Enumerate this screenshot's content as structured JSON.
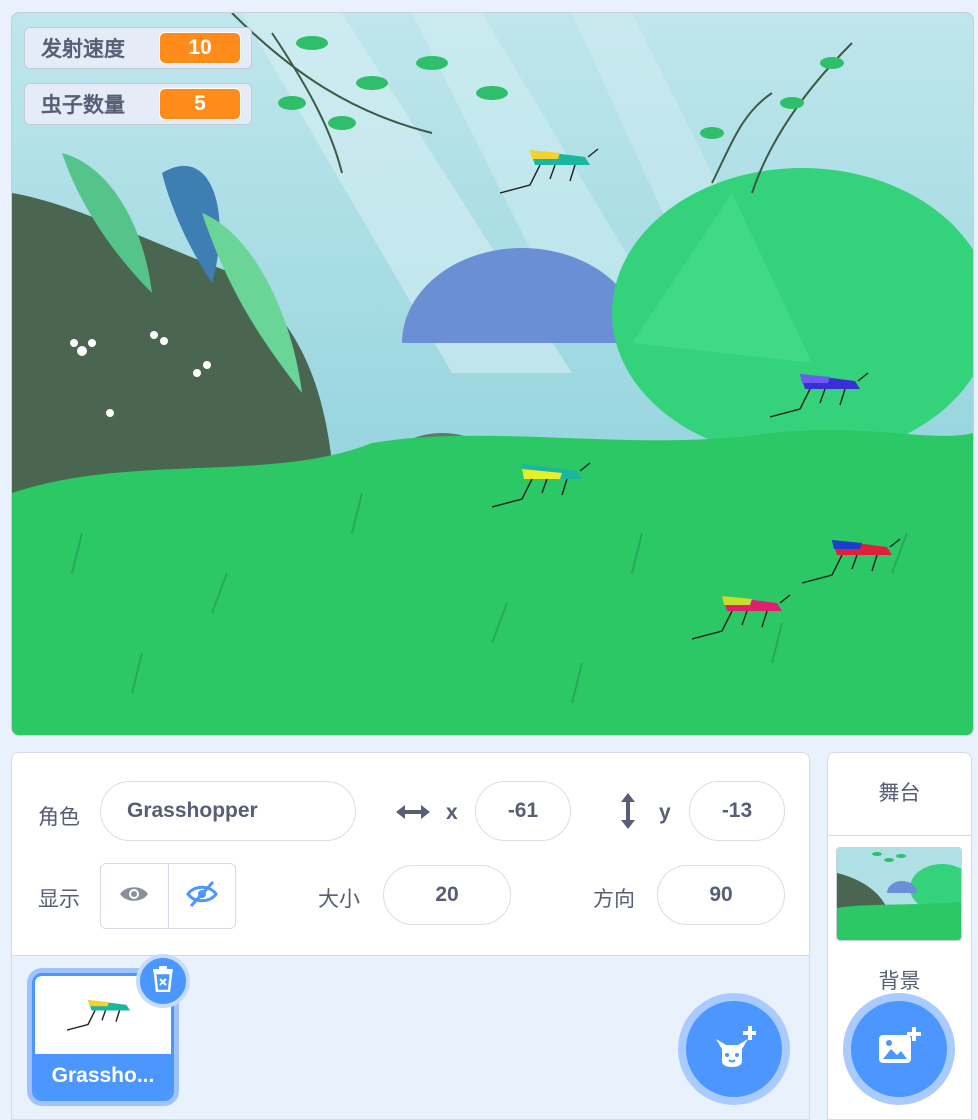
{
  "monitors": [
    {
      "label": "发射速度",
      "value": "10"
    },
    {
      "label": "虫子数量",
      "value": "5"
    }
  ],
  "sprite_info": {
    "sprite_label": "角色",
    "sprite_name": "Grasshopper",
    "x_label": "x",
    "x_value": "-61",
    "y_label": "y",
    "y_value": "-13",
    "show_label": "显示",
    "size_label": "大小",
    "size_value": "20",
    "direction_label": "方向",
    "direction_value": "90"
  },
  "sprite_list": [
    {
      "name": "Grassho..."
    }
  ],
  "stage_panel": {
    "title": "舞台",
    "backdrops_label": "背景"
  },
  "colors": {
    "accent": "#4c97ff",
    "monitor_value": "#ff8c1a",
    "text": "#575e75"
  },
  "icons": {
    "trash": "trash-icon",
    "choose_sprite": "cat-plus-icon",
    "choose_backdrop": "image-plus-icon",
    "show": "eye-icon",
    "hide": "eye-slash-icon"
  }
}
